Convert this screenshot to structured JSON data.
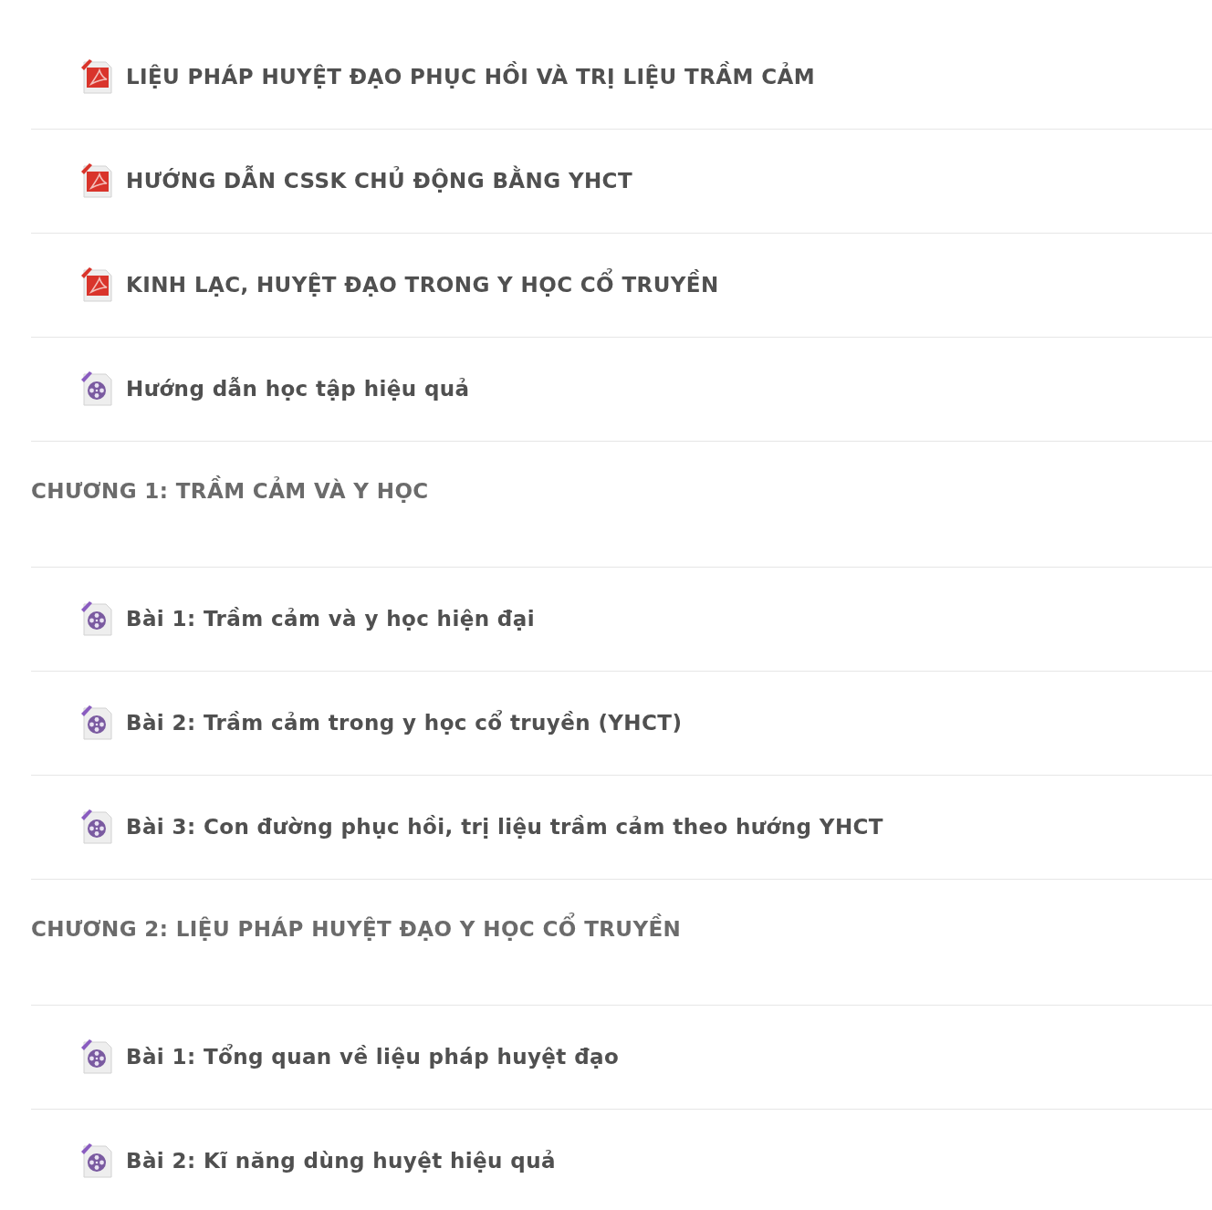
{
  "items": [
    {
      "kind": "pdf",
      "title": "LIỆU PHÁP HUYỆT ĐẠO PHỤC HỒI VÀ TRỊ LIỆU TRẦM CẢM"
    },
    {
      "kind": "pdf",
      "title": "HƯỚNG DẪN CSSK CHỦ ĐỘNG BẰNG YHCT"
    },
    {
      "kind": "pdf",
      "title": "KINH LẠC, HUYỆT ĐẠO TRONG Y HỌC CỔ TRUYỀN"
    },
    {
      "kind": "video",
      "title": "Hướng dẫn học tập hiệu quả"
    },
    {
      "kind": "section",
      "title": "CHƯƠNG 1: TRẦM CẢM VÀ Y HỌC"
    },
    {
      "kind": "video",
      "title": "Bài 1: Trầm cảm và y học hiện đại"
    },
    {
      "kind": "video",
      "title": "Bài 2: Trầm cảm trong y học cổ truyền (YHCT)"
    },
    {
      "kind": "video",
      "title": "Bài 3: Con đường phục hồi, trị liệu trầm cảm theo hướng YHCT"
    },
    {
      "kind": "section",
      "title": "CHƯƠNG 2: LIỆU PHÁP HUYỆT ĐẠO Y HỌC CỔ TRUYỀN"
    },
    {
      "kind": "video",
      "title": "Bài 1: Tổng quan về liệu pháp huyệt đạo"
    },
    {
      "kind": "video",
      "title": "Bài 2: Kĩ năng dùng huyệt hiệu quả"
    }
  ]
}
